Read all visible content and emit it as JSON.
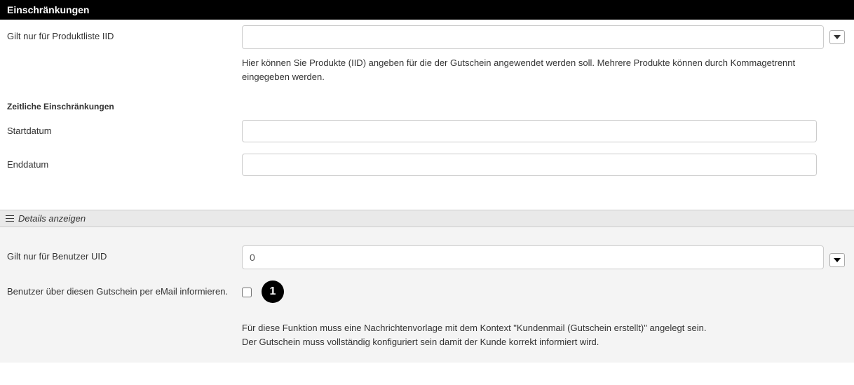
{
  "restrictions": {
    "header": "Einschränkungen",
    "productListLabel": "Gilt nur für Produktliste IID",
    "productListValue": "",
    "productListHelp": "Hier können Sie Produkte (IID) angeben für die der Gutschein angewendet werden soll. Mehrere Produkte können durch Kommagetrennt eingegeben werden.",
    "timeHeader": "Zeitliche Einschränkungen",
    "startDateLabel": "Startdatum",
    "startDateValue": "",
    "endDateLabel": "Enddatum",
    "endDateValue": ""
  },
  "details": {
    "toggleLabel": "Details anzeigen",
    "userUidLabel": "Gilt nur für Benutzer UID",
    "userUidValue": "0",
    "emailLabel": "Benutzer über diesen Gutschein per eMail informieren.",
    "emailChecked": false,
    "badgeNumber": "1",
    "helpLine1": "Für diese Funktion muss eine Nachrichtenvorlage mit dem Kontext \"Kundenmail (Gutschein erstellt)\" angelegt sein.",
    "helpLine2": "Der Gutschein muss vollständig konfiguriert sein damit der Kunde korrekt informiert wird."
  }
}
